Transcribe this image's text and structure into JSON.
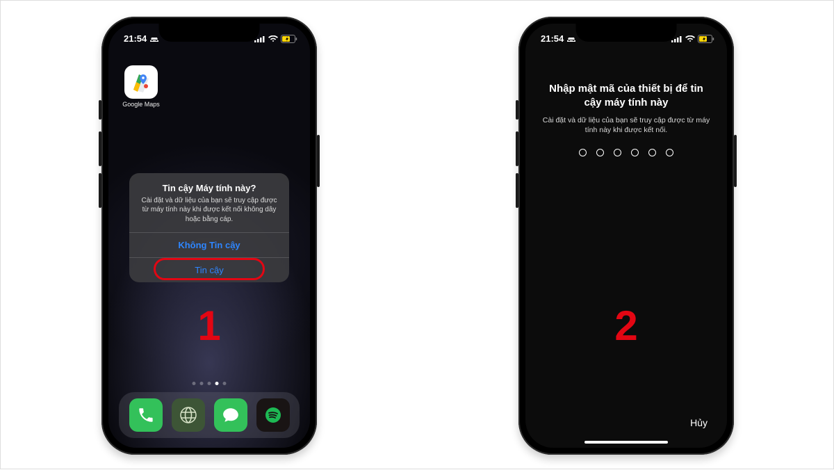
{
  "statusbar": {
    "time": "21:54",
    "carplay_icon": "carplay-icon",
    "wifi_icon": "wifi-icon",
    "signal_icon": "signal-icon",
    "battery_icon": "battery-charging-icon"
  },
  "screen1": {
    "step_label": "1",
    "home_app": {
      "label": "Google Maps"
    },
    "alert": {
      "title": "Tin cậy Máy tính này?",
      "message": "Cài đặt và dữ liệu của bạn sẽ truy cập được từ máy tính này khi được kết nối không dây hoặc bằng cáp.",
      "dont_trust": "Không Tin cậy",
      "trust": "Tin cậy"
    },
    "dock": {
      "phone": "phone-app-icon",
      "browser": "browser-app-icon",
      "messages": "messages-app-icon",
      "spotify": "spotify-app-icon"
    },
    "page_indicator": {
      "count": 5,
      "active_index": 3
    }
  },
  "screen2": {
    "step_label": "2",
    "title": "Nhập mật mã của thiết bị để tin cậy máy tính này",
    "subtitle": "Cài đặt và dữ liệu của bạn sẽ truy cập được từ máy tính này khi được kết nối.",
    "passcode_length": 6,
    "cancel": "Hủy"
  },
  "colors": {
    "accent": "#2e86ff",
    "highlight": "#e30613"
  }
}
